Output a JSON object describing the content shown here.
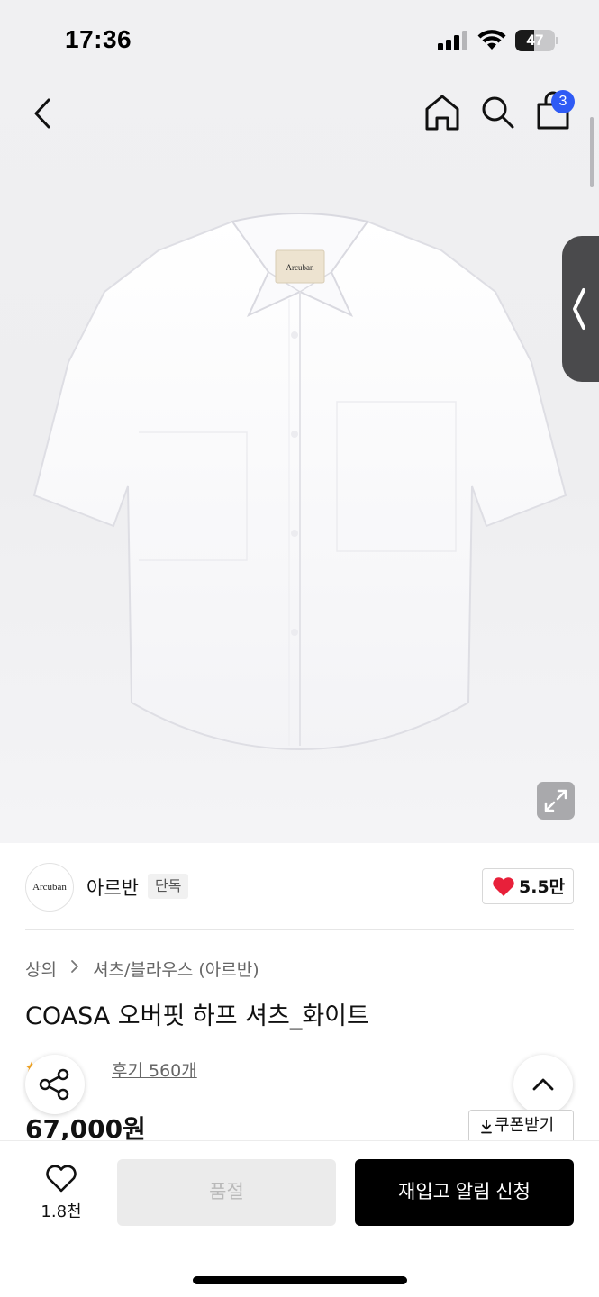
{
  "status_bar": {
    "time": "17:36",
    "battery": "47",
    "battery_fraction": 0.47,
    "icons": [
      "signal-icon",
      "wifi-icon",
      "battery-icon"
    ]
  },
  "nav": {
    "icons": [
      "chevron-left-icon",
      "home-icon",
      "search-icon",
      "shopping-bag-icon"
    ],
    "cart_count": "3"
  },
  "product_image": {
    "label_text": "Arcuban",
    "expand_icon": "expand-icon",
    "side_tab_icon": "chevron-left-icon"
  },
  "brand": {
    "logo_text": "Arcuban",
    "name": "아르반",
    "tag": "단독",
    "like_count": "5.5만",
    "like_color": "#e8203a"
  },
  "product": {
    "breadcrumb": [
      "상의",
      "셔츠/블라우스 (아르반)"
    ],
    "title": "COASA 오버핏 하프 셔츠_화이트",
    "reviews": "후기 560개",
    "price": "67,000원",
    "coupon": "쿠폰받기",
    "star_color": "#f5a623"
  },
  "bottom_bar": {
    "wish_count": "1.8천",
    "soldout_label": "품절",
    "restock_label": "재입고 알림 신청"
  },
  "colors": {
    "badge": "#2f5bf5",
    "primary_button": "#000000",
    "disabled_button": "#ebebeb"
  }
}
